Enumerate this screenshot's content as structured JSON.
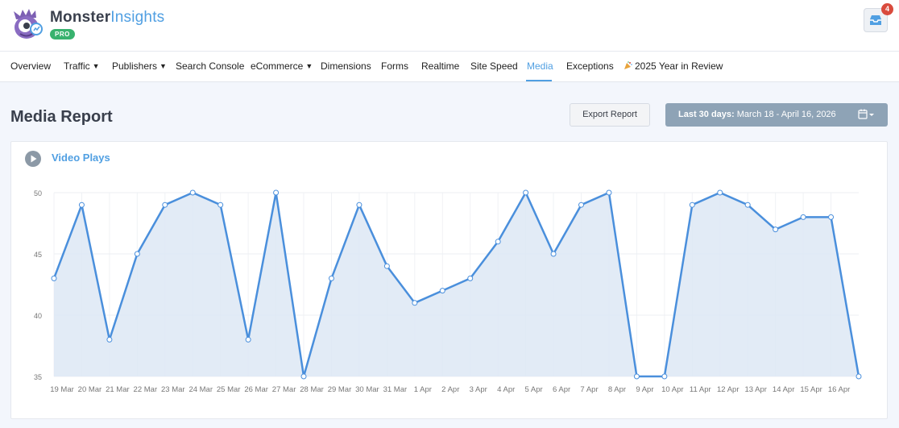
{
  "header": {
    "brand_main": "Monster",
    "brand_accent": "Insights",
    "badge": "PRO",
    "notification_count": "4"
  },
  "nav": {
    "items": [
      {
        "label": "Overview"
      },
      {
        "label": "Traffic"
      },
      {
        "label": "Publishers"
      },
      {
        "label": "Search Console"
      },
      {
        "label": "eCommerce"
      },
      {
        "label": "Dimensions"
      },
      {
        "label": "Forms"
      },
      {
        "label": "Realtime"
      },
      {
        "label": "Site Speed"
      },
      {
        "label": "Media"
      },
      {
        "label": "Exceptions"
      },
      {
        "label": "2025 Year in Review"
      }
    ],
    "active": "Media"
  },
  "page": {
    "title": "Media Report",
    "export_label": "Export Report",
    "date_range_prefix": "Last 30 days:",
    "date_range_value": "March 18 - April 16, 2026"
  },
  "card": {
    "title": "Video Plays"
  },
  "colors": {
    "accent": "#509fe2",
    "line": "#4a8fdc",
    "fill": "#dde8f5",
    "badge_green": "#38b26e",
    "notif_red": "#d94b3d",
    "date_button": "#8ea3b6"
  },
  "chart_data": {
    "type": "area",
    "title": "Video Plays",
    "x": [
      "19 Mar",
      "20 Mar",
      "21 Mar",
      "22 Mar",
      "23 Mar",
      "24 Mar",
      "25 Mar",
      "26 Mar",
      "27 Mar",
      "28 Mar",
      "29 Mar",
      "30 Mar",
      "31 Mar",
      "1 Apr",
      "2 Apr",
      "3 Apr",
      "4 Apr",
      "5 Apr",
      "6 Apr",
      "7 Apr",
      "8 Apr",
      "9 Apr",
      "10 Apr",
      "11 Apr",
      "12 Apr",
      "13 Apr",
      "14 Apr",
      "15 Apr",
      "16 Apr"
    ],
    "values": [
      43,
      49,
      38,
      45,
      49,
      50,
      49,
      38,
      50,
      35,
      43,
      49,
      44,
      41,
      42,
      43,
      46,
      50,
      45,
      49,
      50,
      35,
      35,
      49,
      50,
      49,
      47,
      48,
      48
    ],
    "final_value": 35,
    "ylim": [
      35,
      50
    ],
    "yticks": [
      35,
      40,
      45,
      50
    ],
    "grid": true,
    "xlabel": "",
    "ylabel": ""
  }
}
